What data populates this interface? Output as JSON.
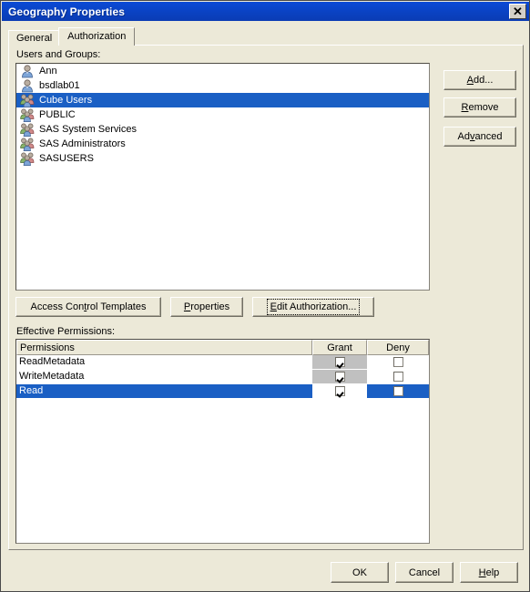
{
  "window": {
    "title": "Geography Properties",
    "close_label": "✕",
    "close_icon": "close-icon"
  },
  "tabs": [
    {
      "label": "General",
      "active": false
    },
    {
      "label": "Authorization",
      "active": true
    }
  ],
  "users_section": {
    "label": "Users and Groups:",
    "items": [
      {
        "name": "Ann",
        "icon": "user-icon",
        "selected": false
      },
      {
        "name": "bsdlab01",
        "icon": "user-icon",
        "selected": false
      },
      {
        "name": "Cube Users",
        "icon": "group-icon",
        "selected": true
      },
      {
        "name": "PUBLIC",
        "icon": "group-icon",
        "selected": false
      },
      {
        "name": "SAS System Services",
        "icon": "group-icon",
        "selected": false
      },
      {
        "name": "SAS Administrators",
        "icon": "group-icon",
        "selected": false
      },
      {
        "name": "SASUSERS",
        "icon": "group-icon",
        "selected": false
      }
    ]
  },
  "side_buttons": [
    {
      "label": "Add...",
      "mnemonic": "A",
      "name": "add-button"
    },
    {
      "label": "Remove",
      "mnemonic": "R",
      "name": "remove-button"
    },
    {
      "label": "Advanced",
      "mnemonic": "v",
      "name": "advanced-button"
    }
  ],
  "action_buttons": [
    {
      "label": "Access Control Templates",
      "mnemonic": "t",
      "name": "access-control-templates-button",
      "focused": false
    },
    {
      "label": "Properties",
      "mnemonic": "P",
      "name": "properties-button",
      "focused": false
    },
    {
      "label": "Edit Authorization...",
      "mnemonic": "E",
      "name": "edit-authorization-button",
      "focused": true
    }
  ],
  "permissions_section": {
    "label": "Effective Permissions:",
    "columns": [
      "Permissions",
      "Grant",
      "Deny"
    ],
    "rows": [
      {
        "permission": "ReadMetadata",
        "grant": true,
        "deny": false,
        "grant_disabled": true,
        "selected": false
      },
      {
        "permission": "WriteMetadata",
        "grant": true,
        "deny": false,
        "grant_disabled": true,
        "selected": false
      },
      {
        "permission": "Read",
        "grant": true,
        "deny": false,
        "grant_disabled": false,
        "selected": true
      }
    ]
  },
  "dialog_buttons": [
    {
      "label": "OK",
      "mnemonic": "",
      "name": "ok-button"
    },
    {
      "label": "Cancel",
      "mnemonic": "",
      "name": "cancel-button"
    },
    {
      "label": "Help",
      "mnemonic": "H",
      "name": "help-button"
    }
  ],
  "colors": {
    "titlebar": "#0a44c8",
    "selection": "#1a5fc4",
    "face": "#ece9d8",
    "disabled_cell": "#c0c0c0"
  }
}
